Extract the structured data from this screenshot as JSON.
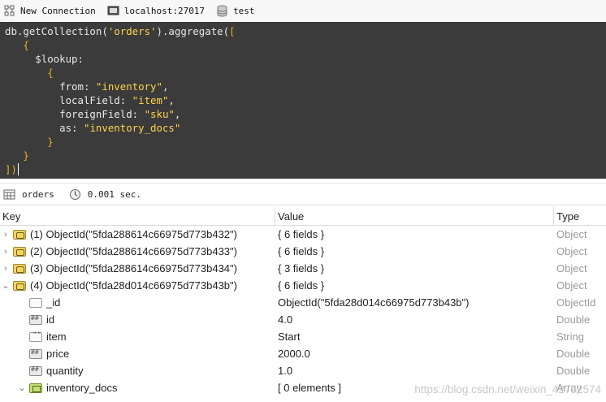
{
  "toolbar": {
    "connection_label": "New Connection",
    "server_label": "localhost:27017",
    "database_label": "test"
  },
  "editor": {
    "lines": [
      [
        {
          "t": "kw",
          "v": "db.getCollection("
        },
        {
          "t": "str",
          "v": "'orders'"
        },
        {
          "t": "kw",
          "v": ").aggregate("
        },
        {
          "t": "br",
          "v": "["
        }
      ],
      [
        {
          "t": "kw",
          "v": "   "
        },
        {
          "t": "br",
          "v": "{"
        }
      ],
      [
        {
          "t": "kw",
          "v": "     $lookup:"
        }
      ],
      [
        {
          "t": "kw",
          "v": "       "
        },
        {
          "t": "br",
          "v": "{"
        }
      ],
      [
        {
          "t": "kw",
          "v": "         from: "
        },
        {
          "t": "str",
          "v": "\"inventory\""
        },
        {
          "t": "kw",
          "v": ","
        }
      ],
      [
        {
          "t": "kw",
          "v": "         localField: "
        },
        {
          "t": "str",
          "v": "\"item\""
        },
        {
          "t": "kw",
          "v": ","
        }
      ],
      [
        {
          "t": "kw",
          "v": "         foreignField: "
        },
        {
          "t": "str",
          "v": "\"sku\""
        },
        {
          "t": "kw",
          "v": ","
        }
      ],
      [
        {
          "t": "kw",
          "v": "         as: "
        },
        {
          "t": "str",
          "v": "\"inventory_docs\""
        }
      ],
      [
        {
          "t": "kw",
          "v": "       "
        },
        {
          "t": "br",
          "v": "}"
        }
      ],
      [
        {
          "t": "kw",
          "v": "   "
        },
        {
          "t": "br",
          "v": "}"
        }
      ],
      [
        {
          "t": "br",
          "v": "])"
        }
      ]
    ]
  },
  "status": {
    "collection": "orders",
    "time": "0.001 sec."
  },
  "columns": {
    "key": "Key",
    "value": "Value",
    "type": "Type"
  },
  "rows": [
    {
      "chev": "›",
      "icon": "obj",
      "indent": 0,
      "key": "(1) ObjectId(\"5fda288614c66975d773b432\")",
      "value": "{ 6 fields }",
      "type": "Object"
    },
    {
      "chev": "›",
      "icon": "obj",
      "indent": 0,
      "key": "(2) ObjectId(\"5fda288614c66975d773b433\")",
      "value": "{ 6 fields }",
      "type": "Object"
    },
    {
      "chev": "›",
      "icon": "obj",
      "indent": 0,
      "key": "(3) ObjectId(\"5fda288614c66975d773b434\")",
      "value": "{ 3 fields }",
      "type": "Object"
    },
    {
      "chev": "⌄",
      "icon": "obj",
      "indent": 0,
      "key": "(4) ObjectId(\"5fda28d014c66975d773b43b\")",
      "value": "{ 6 fields }",
      "type": "Object"
    },
    {
      "chev": "",
      "icon": "id",
      "indent": 1,
      "key": "_id",
      "value": "ObjectId(\"5fda28d014c66975d773b43b\")",
      "type": "ObjectId"
    },
    {
      "chev": "",
      "icon": "num",
      "indent": 1,
      "key": "id",
      "value": "4.0",
      "type": "Double"
    },
    {
      "chev": "",
      "icon": "str",
      "indent": 1,
      "key": "item",
      "value": "Start",
      "type": "String"
    },
    {
      "chev": "",
      "icon": "num",
      "indent": 1,
      "key": "price",
      "value": "2000.0",
      "type": "Double"
    },
    {
      "chev": "",
      "icon": "num",
      "indent": 1,
      "key": "quantity",
      "value": "1.0",
      "type": "Double"
    },
    {
      "chev": "⌄",
      "icon": "arr",
      "indent": 1,
      "key": "inventory_docs",
      "value": "[ 0 elements ]",
      "type": "Array"
    }
  ],
  "watermark": "https://blog.csdn.net/weixin_42752574"
}
